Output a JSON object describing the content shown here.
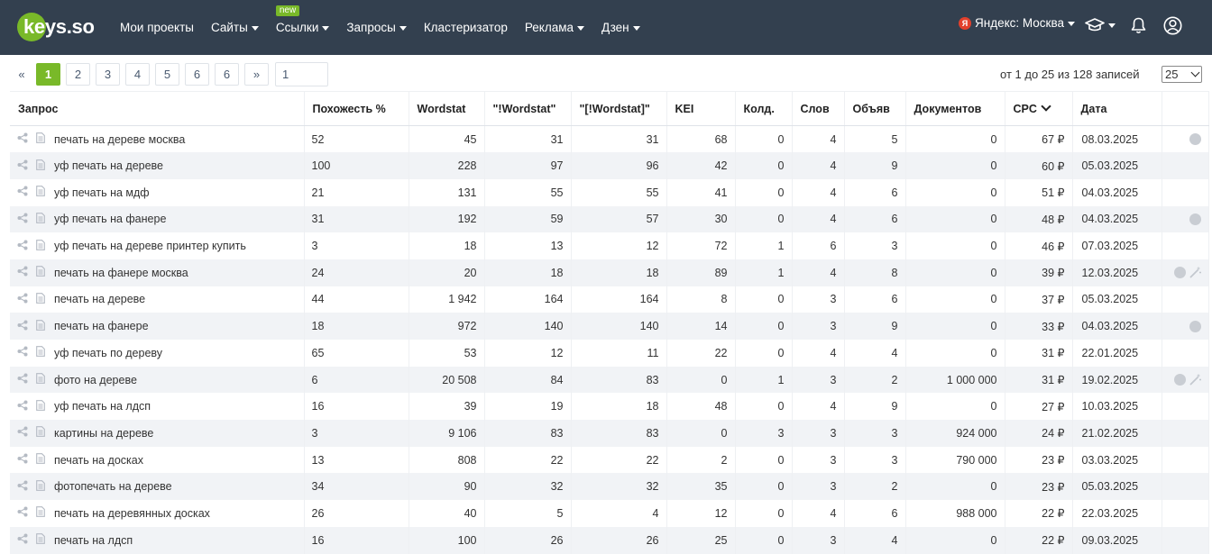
{
  "header": {
    "logo_text": "keys.so",
    "nav": [
      {
        "label": "Мои проекты",
        "dropdown": false,
        "badge": ""
      },
      {
        "label": "Сайты",
        "dropdown": true,
        "badge": ""
      },
      {
        "label": "Ссылки",
        "dropdown": true,
        "badge": "new"
      },
      {
        "label": "Запросы",
        "dropdown": true,
        "badge": ""
      },
      {
        "label": "Кластеризатор",
        "dropdown": false,
        "badge": ""
      },
      {
        "label": "Реклама",
        "dropdown": true,
        "badge": ""
      },
      {
        "label": "Дзен",
        "dropdown": true,
        "badge": ""
      }
    ],
    "region_label": "Яндекс: Москва",
    "region_icon_letter": "Я",
    "icons": [
      "graduation-cap-icon",
      "bell-icon",
      "user-icon"
    ]
  },
  "pagination": {
    "prev": "«",
    "pages": [
      "1",
      "2",
      "3",
      "4",
      "5",
      "6",
      "6"
    ],
    "active_page": "1",
    "next": "»",
    "input_value": "1",
    "records_text": "от 1 до 25 из 128 записей",
    "per_page": "25"
  },
  "table": {
    "columns": [
      "Запрос",
      "Похожесть %",
      "Wordstat",
      "\"!Wordstat\"",
      "\"[!Wordstat]\"",
      "KEI",
      "Колд.",
      "Слов",
      "Объяв",
      "Документов",
      "CPC",
      "Дата",
      ""
    ],
    "sorted_column": "CPC",
    "rows": [
      {
        "query": "печать на дереве москва",
        "sim": "52",
        "ws": "45",
        "ws_exact": "31",
        "ws_order": "31",
        "kei": "68",
        "kold": "0",
        "words": "4",
        "ads": "5",
        "docs": "0",
        "cpc": "67 ₽",
        "date": "08.03.2025",
        "globe": true,
        "wand": false
      },
      {
        "query": "уф печать на дереве",
        "sim": "100",
        "ws": "228",
        "ws_exact": "97",
        "ws_order": "96",
        "kei": "42",
        "kold": "0",
        "words": "4",
        "ads": "9",
        "docs": "0",
        "cpc": "60 ₽",
        "date": "05.03.2025",
        "globe": false,
        "wand": false
      },
      {
        "query": "уф печать на мдф",
        "sim": "21",
        "ws": "131",
        "ws_exact": "55",
        "ws_order": "55",
        "kei": "41",
        "kold": "0",
        "words": "4",
        "ads": "6",
        "docs": "0",
        "cpc": "51 ₽",
        "date": "04.03.2025",
        "globe": false,
        "wand": false
      },
      {
        "query": "уф печать на фанере",
        "sim": "31",
        "ws": "192",
        "ws_exact": "59",
        "ws_order": "57",
        "kei": "30",
        "kold": "0",
        "words": "4",
        "ads": "6",
        "docs": "0",
        "cpc": "48 ₽",
        "date": "04.03.2025",
        "globe": true,
        "wand": false
      },
      {
        "query": "уф печать на дереве принтер купить",
        "sim": "3",
        "ws": "18",
        "ws_exact": "13",
        "ws_order": "12",
        "kei": "72",
        "kold": "1",
        "words": "6",
        "ads": "3",
        "docs": "0",
        "cpc": "46 ₽",
        "date": "07.03.2025",
        "globe": false,
        "wand": false
      },
      {
        "query": "печать на фанере москва",
        "sim": "24",
        "ws": "20",
        "ws_exact": "18",
        "ws_order": "18",
        "kei": "89",
        "kold": "1",
        "words": "4",
        "ads": "8",
        "docs": "0",
        "cpc": "39 ₽",
        "date": "12.03.2025",
        "globe": true,
        "wand": true
      },
      {
        "query": "печать на дереве",
        "sim": "44",
        "ws": "1 942",
        "ws_exact": "164",
        "ws_order": "164",
        "kei": "8",
        "kold": "0",
        "words": "3",
        "ads": "6",
        "docs": "0",
        "cpc": "37 ₽",
        "date": "05.03.2025",
        "globe": false,
        "wand": false
      },
      {
        "query": "печать на фанере",
        "sim": "18",
        "ws": "972",
        "ws_exact": "140",
        "ws_order": "140",
        "kei": "14",
        "kold": "0",
        "words": "3",
        "ads": "9",
        "docs": "0",
        "cpc": "33 ₽",
        "date": "04.03.2025",
        "globe": true,
        "wand": false
      },
      {
        "query": "уф печать по дереву",
        "sim": "65",
        "ws": "53",
        "ws_exact": "12",
        "ws_order": "11",
        "kei": "22",
        "kold": "0",
        "words": "4",
        "ads": "4",
        "docs": "0",
        "cpc": "31 ₽",
        "date": "22.01.2025",
        "globe": false,
        "wand": false
      },
      {
        "query": "фото на дереве",
        "sim": "6",
        "ws": "20 508",
        "ws_exact": "84",
        "ws_order": "83",
        "kei": "0",
        "kold": "1",
        "words": "3",
        "ads": "2",
        "docs": "1 000 000",
        "cpc": "31 ₽",
        "date": "19.02.2025",
        "globe": true,
        "wand": true
      },
      {
        "query": "уф печать на лдсп",
        "sim": "16",
        "ws": "39",
        "ws_exact": "19",
        "ws_order": "18",
        "kei": "48",
        "kold": "0",
        "words": "4",
        "ads": "9",
        "docs": "0",
        "cpc": "27 ₽",
        "date": "10.03.2025",
        "globe": false,
        "wand": false
      },
      {
        "query": "картины на дереве",
        "sim": "3",
        "ws": "9 106",
        "ws_exact": "83",
        "ws_order": "83",
        "kei": "0",
        "kold": "3",
        "words": "3",
        "ads": "3",
        "docs": "924 000",
        "cpc": "24 ₽",
        "date": "21.02.2025",
        "globe": false,
        "wand": false
      },
      {
        "query": "печать на досках",
        "sim": "13",
        "ws": "808",
        "ws_exact": "22",
        "ws_order": "22",
        "kei": "2",
        "kold": "0",
        "words": "3",
        "ads": "3",
        "docs": "790 000",
        "cpc": "23 ₽",
        "date": "03.03.2025",
        "globe": false,
        "wand": false
      },
      {
        "query": "фотопечать на дереве",
        "sim": "34",
        "ws": "90",
        "ws_exact": "32",
        "ws_order": "32",
        "kei": "35",
        "kold": "0",
        "words": "3",
        "ads": "2",
        "docs": "0",
        "cpc": "23 ₽",
        "date": "05.03.2025",
        "globe": false,
        "wand": false
      },
      {
        "query": "печать на деревянных досках",
        "sim": "26",
        "ws": "40",
        "ws_exact": "5",
        "ws_order": "4",
        "kei": "12",
        "kold": "0",
        "words": "4",
        "ads": "6",
        "docs": "988 000",
        "cpc": "22 ₽",
        "date": "22.03.2025",
        "globe": false,
        "wand": false
      },
      {
        "query": "печать на лдсп",
        "sim": "16",
        "ws": "100",
        "ws_exact": "26",
        "ws_order": "26",
        "kei": "25",
        "kold": "0",
        "words": "3",
        "ads": "4",
        "docs": "0",
        "cpc": "22 ₽",
        "date": "09.03.2025",
        "globe": false,
        "wand": false
      }
    ]
  },
  "colors": {
    "header_bg": "#33404f",
    "accent": "#79b929",
    "row_alt": "#f1f3f6"
  }
}
